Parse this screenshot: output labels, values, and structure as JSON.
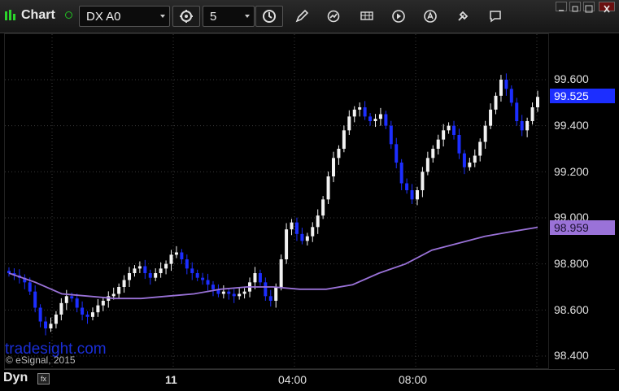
{
  "header": {
    "title": "Chart",
    "symbol": "DX A0",
    "interval": "5"
  },
  "price_axis": {
    "labels": [
      "99.600",
      "99.400",
      "99.200",
      "99.000",
      "98.800",
      "98.600",
      "98.400"
    ]
  },
  "price_flags": {
    "last": "99.525",
    "ma": "98.959"
  },
  "time_axis": {
    "labels": [
      "11",
      "04:00",
      "08:00"
    ]
  },
  "footer": {
    "dyn_label": "Dyn"
  },
  "watermark": {
    "site": "tradesight.com",
    "copyright": "© eSignal, 2015"
  },
  "colors": {
    "up": "#f2f2f2",
    "down": "#1c2eff",
    "ma": "#9a72d8",
    "flag_last": "#1c2eff",
    "flag_ma": "#9a72d8"
  },
  "chart_data": {
    "type": "candlestick",
    "ylim": [
      98.4,
      99.6
    ],
    "x_ticks": [
      "11",
      "04:00",
      "08:00"
    ],
    "closes": [
      98.76,
      98.75,
      98.74,
      98.72,
      98.68,
      98.61,
      98.55,
      98.52,
      98.54,
      98.58,
      98.63,
      98.66,
      98.65,
      98.61,
      98.58,
      98.57,
      98.59,
      98.62,
      98.64,
      98.66,
      98.67,
      98.7,
      98.73,
      98.76,
      98.78,
      98.79,
      98.76,
      98.74,
      98.76,
      98.78,
      98.8,
      98.84,
      98.85,
      98.82,
      98.78,
      98.76,
      98.74,
      98.73,
      98.71,
      98.69,
      98.67,
      98.68,
      98.67,
      98.66,
      98.67,
      98.68,
      98.72,
      98.76,
      98.72,
      98.66,
      98.64,
      98.7,
      98.82,
      98.95,
      98.98,
      98.93,
      98.9,
      98.92,
      98.96,
      99.01,
      99.08,
      99.18,
      99.26,
      99.3,
      99.38,
      99.44,
      99.47,
      99.48,
      99.44,
      99.42,
      99.43,
      99.45,
      99.4,
      99.32,
      99.24,
      99.15,
      99.12,
      99.08,
      99.12,
      99.2,
      99.26,
      99.3,
      99.34,
      99.38,
      99.4,
      99.36,
      99.28,
      99.22,
      99.24,
      99.27,
      99.33,
      99.4,
      99.47,
      99.53,
      99.6,
      99.56,
      99.5,
      99.42,
      99.38,
      99.42,
      99.48,
      99.525
    ],
    "ma_values": [
      98.76,
      98.72,
      98.67,
      98.66,
      98.65,
      98.65,
      98.66,
      98.67,
      98.69,
      98.7,
      98.7,
      98.69,
      98.69,
      98.71,
      98.76,
      98.8,
      98.86,
      98.89,
      98.92,
      98.94,
      98.959
    ]
  }
}
